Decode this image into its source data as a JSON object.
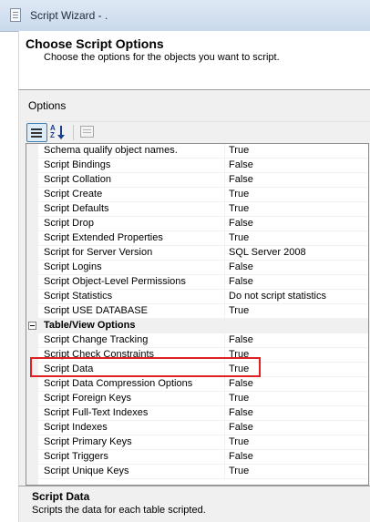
{
  "window": {
    "title": "Script Wizard - ."
  },
  "header": {
    "title": "Choose Script Options",
    "subtitle": "Choose the options for the objects you want to script."
  },
  "options": {
    "label": "Options",
    "toolbar": {
      "categorized_icon": "categorized-icon",
      "alphabetical_icon": "alphabetical-icon",
      "property_pages_icon": "property-pages-icon"
    },
    "general_rows": [
      {
        "name": "Schema qualify object names.",
        "value": "True"
      },
      {
        "name": "Script Bindings",
        "value": "False"
      },
      {
        "name": "Script Collation",
        "value": "False"
      },
      {
        "name": "Script Create",
        "value": "True"
      },
      {
        "name": "Script Defaults",
        "value": "True"
      },
      {
        "name": "Script Drop",
        "value": "False"
      },
      {
        "name": "Script Extended Properties",
        "value": "True"
      },
      {
        "name": "Script for Server Version",
        "value": "SQL Server 2008"
      },
      {
        "name": "Script Logins",
        "value": "False"
      },
      {
        "name": "Script Object-Level Permissions",
        "value": "False"
      },
      {
        "name": "Script Statistics",
        "value": "Do not script statistics"
      },
      {
        "name": "Script USE DATABASE",
        "value": "True"
      }
    ],
    "category": {
      "label": "Table/View Options",
      "toggle": "−"
    },
    "table_rows": [
      {
        "name": "Script Change Tracking",
        "value": "False"
      },
      {
        "name": "Script Check Constraints",
        "value": "True"
      },
      {
        "name": "Script Data",
        "value": "True"
      },
      {
        "name": "Script Data Compression Options",
        "value": "False"
      },
      {
        "name": "Script Foreign Keys",
        "value": "True"
      },
      {
        "name": "Script Full-Text Indexes",
        "value": "False"
      },
      {
        "name": "Script Indexes",
        "value": "False"
      },
      {
        "name": "Script Primary Keys",
        "value": "True"
      },
      {
        "name": "Script Triggers",
        "value": "False"
      },
      {
        "name": "Script Unique Keys",
        "value": "True"
      }
    ]
  },
  "description": {
    "title": "Script Data",
    "text": "Scripts the data for each table scripted."
  },
  "colors": {
    "highlight": "#e02020",
    "selection_border": "#3c7fb1"
  }
}
